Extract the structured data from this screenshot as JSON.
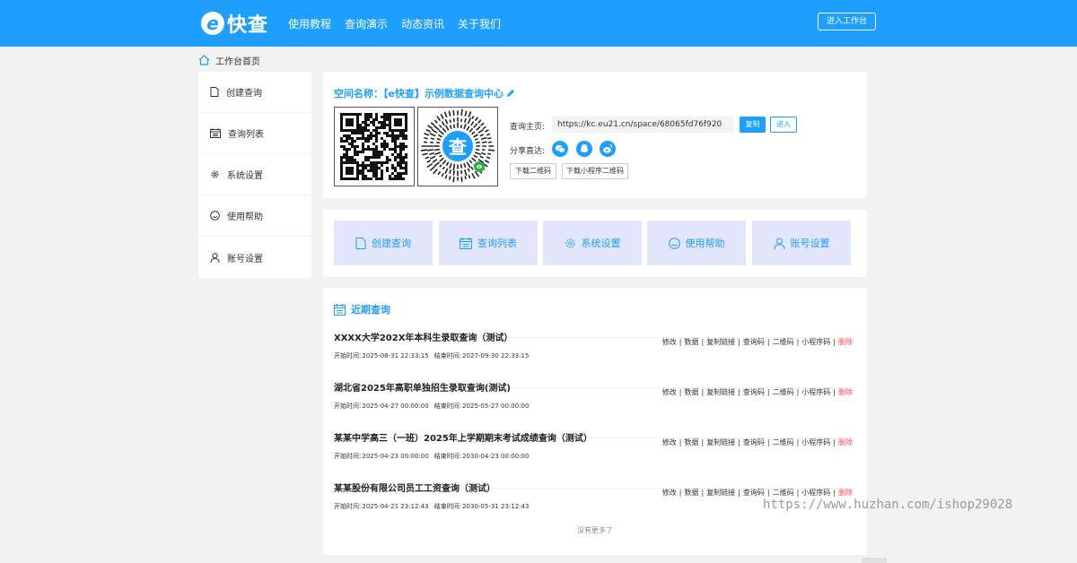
{
  "header": {
    "logo_letter": "e",
    "logo_text": "快查",
    "nav": [
      "使用教程",
      "查询演示",
      "动态资讯",
      "关于我们"
    ],
    "workbench_button": "进入工作台"
  },
  "breadcrumb": "工作台首页",
  "sidebar": {
    "items": [
      {
        "label": "创建查询",
        "icon": "document-icon"
      },
      {
        "label": "查询列表",
        "icon": "list-icon"
      },
      {
        "label": "系统设置",
        "icon": "gear-icon"
      },
      {
        "label": "使用帮助",
        "icon": "smile-icon"
      },
      {
        "label": "账号设置",
        "icon": "user-icon"
      }
    ]
  },
  "space": {
    "title": "空间名称：【e快查】示例数据查询中心",
    "qr_center_text": "查",
    "home_label": "查询主页:",
    "home_url": "https://kc.eu21.cn/space/68065fd76f920",
    "copy_button": "复制",
    "enter_button": "进入",
    "share_label": "分享直达:",
    "share_icons": [
      "wechat-icon",
      "qq-icon",
      "weibo-icon"
    ],
    "download_qr": "下载二维码",
    "download_mini": "下载小程序二维码"
  },
  "quick": [
    {
      "label": "创建查询",
      "icon": "document-icon"
    },
    {
      "label": "查询列表",
      "icon": "list-icon"
    },
    {
      "label": "系统设置",
      "icon": "gear-icon"
    },
    {
      "label": "使用帮助",
      "icon": "smile-icon"
    },
    {
      "label": "账号设置",
      "icon": "user-icon"
    }
  ],
  "recent": {
    "title": "近期查询",
    "start_label": "开始时间:",
    "end_label": "结束时间:",
    "ops": [
      "修改",
      "数据",
      "复制链接",
      "查询码",
      "二维码",
      "小程序码",
      "删除"
    ],
    "items": [
      {
        "title": "XXXX大学202X年本科生录取查询（测试）",
        "start": "2025-08-31 22:33:15",
        "end": "2027-09-30 22:33:15"
      },
      {
        "title": "湖北省2025年高职单独招生录取查询(测试)",
        "start": "2025-04-27 00:00:00",
        "end": "2025-05-27 00:00:00"
      },
      {
        "title": "某某中学高三（一班）2025年上学期期末考试成绩查询（测试）",
        "start": "2025-04-23 00:00:00",
        "end": "2030-04-23 00:00:00"
      },
      {
        "title": "某某股份有限公司员工工资查询（测试）",
        "start": "2025-04-21 23:12:43",
        "end": "2030-05-31 23:12:43"
      }
    ],
    "no_more": "没有更多了"
  },
  "watermark": "https://www.huzhan.com/ishop29028",
  "colors": {
    "brand": "#1e9fff",
    "danger": "#ff4d4f",
    "card": "#e3e6fb"
  }
}
